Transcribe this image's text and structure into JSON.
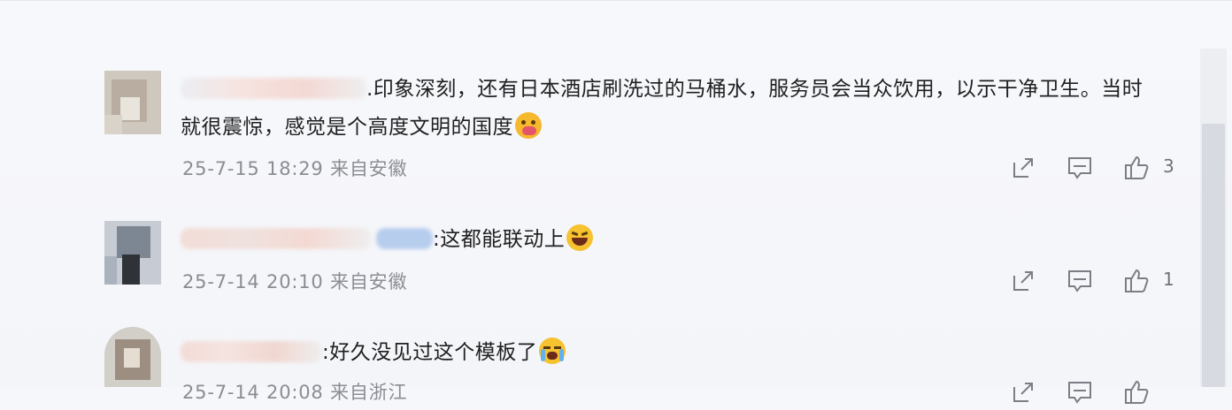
{
  "comments": [
    {
      "text": ".印象深刻，还有日本酒店刷洗过的马桶水，服务员会当众饮用，以示干净卫生。当时就很震惊，感觉是个高度文明的国度",
      "emoji": "face-with-hand-over-mouth-emoji",
      "time": "25-7-15 18:29",
      "location": "来自安徽",
      "likes": "3"
    },
    {
      "text": ":这都能联动上",
      "emoji": "grinning-squinting-face-emoji",
      "time": "25-7-14 20:10",
      "location": "来自安徽",
      "likes": "1"
    },
    {
      "text": ":好久没见过这个模板了",
      "emoji": "loudly-crying-face-emoji",
      "time": "25-7-14 20:08",
      "location": "来自浙江",
      "likes": ""
    }
  ],
  "icons": {
    "share": "share-icon",
    "reply": "comment-icon",
    "like": "thumbs-up-icon"
  },
  "colors": {
    "background": "#f6f7fb",
    "text": "#1f1f1f",
    "meta": "#8a8d93",
    "icon": "#7b7e85"
  }
}
